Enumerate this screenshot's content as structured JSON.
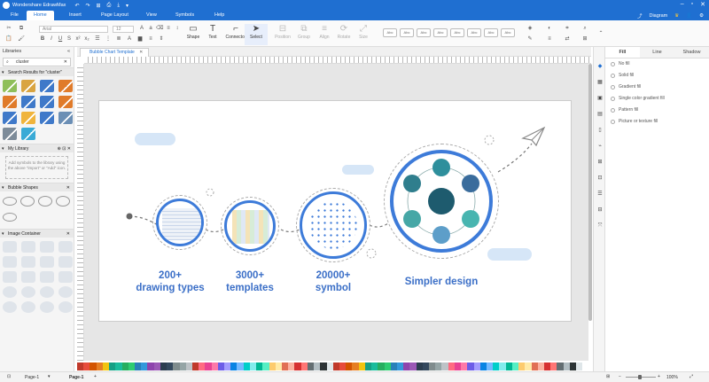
{
  "app": {
    "title": "Wondershare EdrawMax"
  },
  "titlebar": {
    "quick_access": [
      "↶",
      "↷",
      "⊞",
      "⎙",
      "⤓",
      "▾"
    ],
    "window_buttons": [
      "–",
      "▫",
      "✕"
    ]
  },
  "tabs": [
    "File",
    "Home",
    "Insert",
    "Page Layout",
    "View",
    "Symbols",
    "Help"
  ],
  "active_tab": "Home",
  "header_right": {
    "diagram_label": "Diagram"
  },
  "ribbon": {
    "font_placeholder": "Arial",
    "font_size": "12",
    "tools": [
      {
        "label": "Shape",
        "icon": "▭"
      },
      {
        "label": "Text",
        "icon": "T"
      },
      {
        "label": "Connector",
        "icon": "⌐"
      },
      {
        "label": "Select",
        "icon": "➤"
      },
      {
        "label": "Position",
        "icon": "⊟"
      },
      {
        "label": "Group",
        "icon": "⧉"
      },
      {
        "label": "Align",
        "icon": "≡"
      },
      {
        "label": "Rotate",
        "icon": "⟳"
      },
      {
        "label": "Size",
        "icon": "⤢"
      }
    ],
    "style_box_label": "Abc"
  },
  "libraries": {
    "title": "Libraries",
    "search_value": "cluster",
    "sections": {
      "search_results": "Search Results for \"cluster\"",
      "my_library": "My Library",
      "bubble_shapes": "Bubble Shapes",
      "image_container": "Image Container"
    },
    "my_library_hint": "Add symbols to the library using the above \"import\" or \"Add\" icon.",
    "thumb_colors": [
      "#8fbf5a",
      "#d9a441",
      "#3f79c9",
      "#e07b2a",
      "#e07b2a",
      "#3f79c9",
      "#3f79c9",
      "#e07b2a",
      "#3f79c9",
      "#f0b43c",
      "#3f79c9",
      "#6b8fb5",
      "#7c8b99",
      "#3aaad6"
    ]
  },
  "document": {
    "tab_title": "Bubble Chart Template"
  },
  "canvas": {
    "captions": [
      {
        "line1": "200+",
        "line2": "drawing types"
      },
      {
        "line1": "3000+",
        "line2": "templates"
      },
      {
        "line1": "20000+",
        "line2": "symbol"
      },
      {
        "line1": "Simpler design",
        "line2": ""
      }
    ],
    "accent_color": "#3d7bd9",
    "caption_color": "#3b6fc7",
    "node_colors": [
      "#2e8f9c",
      "#3a6c9c",
      "#48b5b0",
      "#5d9ec9",
      "#46a7a6",
      "#2f7e8d",
      "#1e5b6e"
    ]
  },
  "right_panel": {
    "tabs": [
      "Fill",
      "Line",
      "Shadow"
    ],
    "active_tab": "Fill",
    "fill_options": [
      "No fill",
      "Solid fill",
      "Gradient fill",
      "Single color gradient fill",
      "Pattern fill",
      "Picture or texture fill"
    ]
  },
  "status": {
    "page_selector": "Page-1",
    "page_tab": "Page-1",
    "zoom": "100%"
  },
  "palette": [
    "#c0392b",
    "#e74c3c",
    "#d35400",
    "#e67e22",
    "#f1c40f",
    "#16a085",
    "#1abc9c",
    "#27ae60",
    "#2ecc71",
    "#2980b9",
    "#3498db",
    "#8e44ad",
    "#9b59b6",
    "#2c3e50",
    "#34495e",
    "#7f8c8d",
    "#95a5a6",
    "#bdc3c7",
    "#c0392b",
    "#ff6b81",
    "#e84393",
    "#fd79a8",
    "#6c5ce7",
    "#a29bfe",
    "#0984e3",
    "#74b9ff",
    "#00cec9",
    "#81ecec",
    "#00b894",
    "#55efc4",
    "#fdcb6e",
    "#ffeaa7",
    "#e17055",
    "#fab1a0",
    "#d63031",
    "#ff7675",
    "#636e72",
    "#b2bec3",
    "#2d3436",
    "#dfe6e9",
    "#c0392b",
    "#e74c3c",
    "#d35400",
    "#e67e22",
    "#f1c40f",
    "#16a085",
    "#1abc9c",
    "#27ae60",
    "#2ecc71",
    "#2980b9",
    "#3498db",
    "#8e44ad",
    "#9b59b6",
    "#2c3e50",
    "#34495e",
    "#7f8c8d",
    "#95a5a6",
    "#bdc3c7",
    "#ff6b81",
    "#e84393",
    "#fd79a8",
    "#6c5ce7",
    "#a29bfe",
    "#0984e3",
    "#74b9ff",
    "#00cec9",
    "#81ecec",
    "#00b894",
    "#55efc4",
    "#fdcb6e",
    "#ffeaa7",
    "#e17055",
    "#fab1a0",
    "#d63031",
    "#ff7675",
    "#636e72",
    "#b2bec3",
    "#2d3436",
    "#dfe6e9",
    "#ffffff"
  ]
}
